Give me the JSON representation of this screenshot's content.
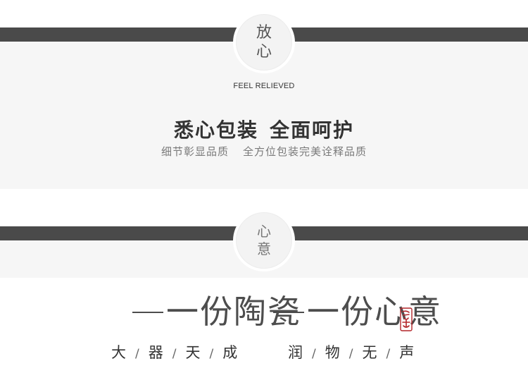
{
  "section1": {
    "badge": [
      "放",
      "心"
    ],
    "subtitle_en": "FEEL RELIEVED",
    "headline": [
      "悉心包装",
      "全面呵护"
    ],
    "subline": [
      "细节彰显品质",
      "全方位包装完美诠释品质"
    ]
  },
  "section2": {
    "badge": [
      "心",
      "意"
    ],
    "slogan_left": "一份陶瓷",
    "slogan_right": "一份心意",
    "seal_text": "",
    "tagline_left": [
      "大",
      "器",
      "天",
      "成"
    ],
    "tagline_right": [
      "润",
      "物",
      "无",
      "声"
    ],
    "separator": "/"
  },
  "colors": {
    "bar": "#4a4a4a",
    "panel": "#f6f6f6",
    "seal": "#b3262a"
  }
}
